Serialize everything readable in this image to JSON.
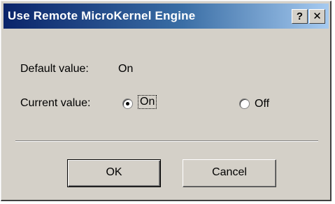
{
  "dialog": {
    "title": "Use Remote MicroKernel Engine",
    "help_glyph": "?",
    "close_glyph": "✕"
  },
  "default_value": {
    "label": "Default value:",
    "value": "On"
  },
  "current_value": {
    "label": "Current value:",
    "options": [
      {
        "label": "On",
        "selected": true
      },
      {
        "label": "Off",
        "selected": false
      }
    ]
  },
  "buttons": {
    "ok": "OK",
    "cancel": "Cancel"
  }
}
